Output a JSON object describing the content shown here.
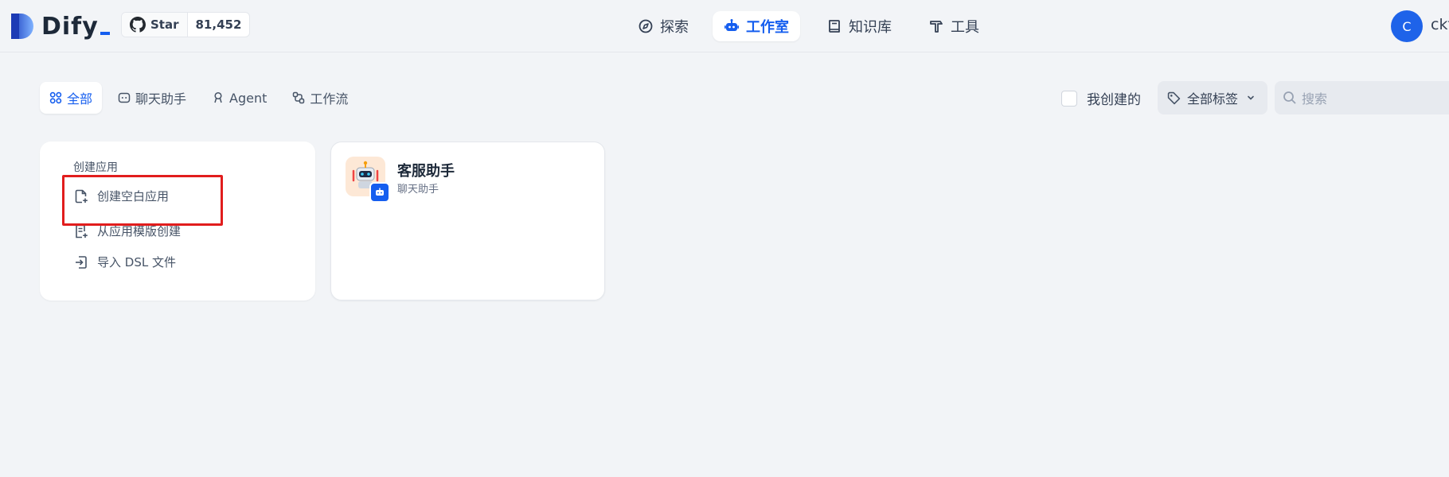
{
  "header": {
    "logo_text": "Dify",
    "github": {
      "label": "Star",
      "count": "81,452"
    },
    "nav": [
      {
        "label": "探索",
        "icon": "compass-icon",
        "active": false
      },
      {
        "label": "工作室",
        "icon": "robot-icon",
        "active": true
      },
      {
        "label": "知识库",
        "icon": "book-icon",
        "active": false
      },
      {
        "label": "工具",
        "icon": "hammer-icon",
        "active": false
      }
    ],
    "user": {
      "avatar_letter": "C",
      "name": "ckf"
    }
  },
  "filters": {
    "tabs": [
      {
        "label": "全部",
        "icon": "grid-icon",
        "active": true
      },
      {
        "label": "聊天助手",
        "icon": "chat-icon",
        "active": false
      },
      {
        "label": "Agent",
        "icon": "agent-icon",
        "active": false
      },
      {
        "label": "工作流",
        "icon": "workflow-icon",
        "active": false
      }
    ],
    "mine_label": "我创建的",
    "tags_label": "全部标签",
    "search_placeholder": "搜索"
  },
  "create_card": {
    "title": "创建应用",
    "items": [
      {
        "label": "创建空白应用",
        "icon": "file-plus-icon"
      },
      {
        "label": "从应用模版创建",
        "icon": "template-icon"
      },
      {
        "label": "导入 DSL 文件",
        "icon": "import-icon"
      }
    ]
  },
  "apps": [
    {
      "name": "客服助手",
      "type": "聊天助手",
      "icon": "robot-avatar-icon"
    }
  ],
  "colors": {
    "accent": "#155eef",
    "background": "#f2f4f7",
    "highlight": "#e11d1d"
  }
}
